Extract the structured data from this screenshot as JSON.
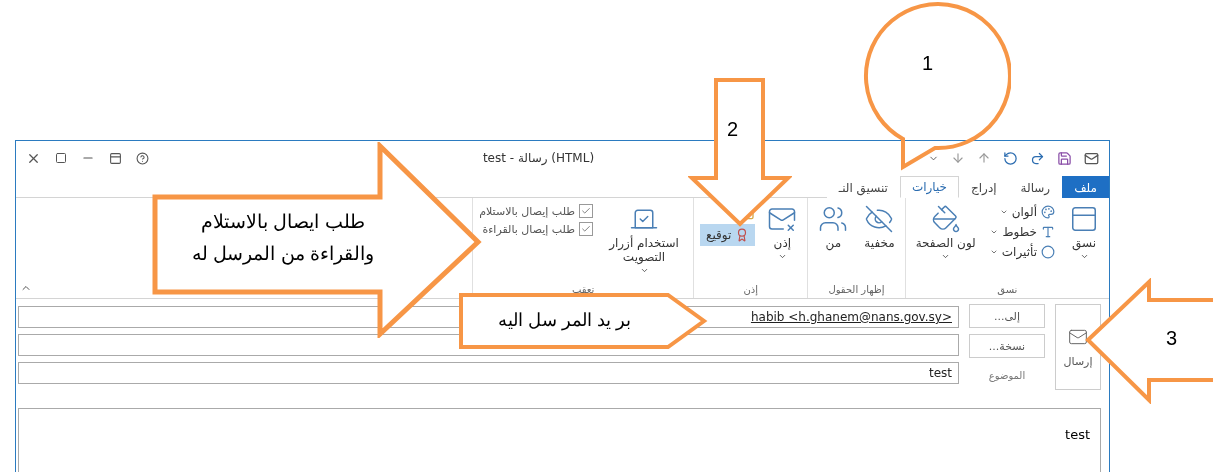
{
  "window": {
    "title": "test - رسالة (HTML)"
  },
  "tabs": [
    {
      "label": "ملف",
      "kind": "file",
      "selected": false
    },
    {
      "label": "رسالة",
      "kind": "tab",
      "selected": false
    },
    {
      "label": "إدراج",
      "kind": "tab",
      "selected": false
    },
    {
      "label": "خيارات",
      "kind": "tab",
      "selected": true
    },
    {
      "label": "تنسيق النـ",
      "kind": "tab",
      "selected": false
    }
  ],
  "ribbon": {
    "groups": [
      {
        "label": "نسق",
        "items": [
          {
            "kind": "large",
            "label": "نسق",
            "dropdown": true
          },
          {
            "kind": "stack",
            "items": [
              {
                "label": "ألوان"
              },
              {
                "label": "خطوط"
              },
              {
                "label": "تأثيرات"
              }
            ]
          },
          {
            "kind": "large",
            "label": "لون الصفحة",
            "dropdown": true
          }
        ]
      },
      {
        "label": "إظهار الحقول",
        "items": [
          {
            "kind": "large",
            "label": "مخفية",
            "dropdown": false
          },
          {
            "kind": "large",
            "label": "من",
            "dropdown": false
          }
        ]
      },
      {
        "label": "إذن",
        "items": [
          {
            "kind": "large",
            "label": "إذن",
            "dropdown": true
          },
          {
            "kind": "toggles",
            "items": [
              {
                "label": "توقيع",
                "on": true
              }
            ]
          }
        ]
      },
      {
        "label": "تعقب",
        "items": [
          {
            "kind": "large",
            "label": "استخدام أزرار التصويت",
            "dropdown": true
          },
          {
            "kind": "checks",
            "items": [
              {
                "label": "طلب إيصال بالاستلام",
                "checked": true
              },
              {
                "label": "طلب إيصال بالقراءة",
                "checked": true
              }
            ]
          }
        ]
      }
    ]
  },
  "header": {
    "send": "إرسال",
    "to_button": "إلى...",
    "cc_button": "نسخة...",
    "subject_label": "الموضوع",
    "to": "habib <h.ghanem@nans.gov.sy>",
    "subject": "test"
  },
  "body": "test",
  "callouts": [
    {
      "kind": "bubble",
      "text": "1"
    },
    {
      "kind": "down-arrow",
      "text": "2"
    },
    {
      "kind": "left-arrow",
      "text": "3"
    },
    {
      "kind": "right-arrow",
      "text": "طلب ايصال بالاستلام والقراءة من المرسل له"
    },
    {
      "kind": "tag",
      "text": "بر يد المر سل اليه"
    }
  ]
}
